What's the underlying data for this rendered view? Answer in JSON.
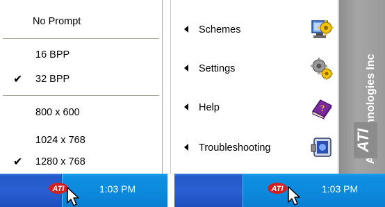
{
  "left_menu": {
    "items": [
      {
        "label": "No Prompt",
        "checked": false
      },
      {
        "label": "16 BPP",
        "checked": false
      },
      {
        "label": "32 BPP",
        "checked": true
      },
      {
        "label": "800 x 600",
        "checked": false
      },
      {
        "label": "1024 x 768",
        "checked": false
      },
      {
        "label": "1280 x 768",
        "checked": true
      }
    ],
    "check_glyph": "✔"
  },
  "right_menu": {
    "items": [
      {
        "label": "Schemes",
        "icon": "schemes-gear-monitor-icon"
      },
      {
        "label": "Settings",
        "icon": "settings-gears-icon"
      },
      {
        "label": "Help",
        "icon": "help-book-icon"
      },
      {
        "label": "Troubleshooting",
        "icon": "troubleshooting-monitor-icon"
      }
    ],
    "brand_text": "ATI Technologies Inc"
  },
  "taskbar": {
    "left_time": "1:03 PM",
    "right_time": "1:03 PM",
    "tray_icon": "ati-tray-icon"
  },
  "colors": {
    "taskbar_blue": "#2a5fd3",
    "tray_blue": "#0f8ee2",
    "ati_red": "#d21f1f",
    "banner_gray": "#9a9a9a"
  }
}
